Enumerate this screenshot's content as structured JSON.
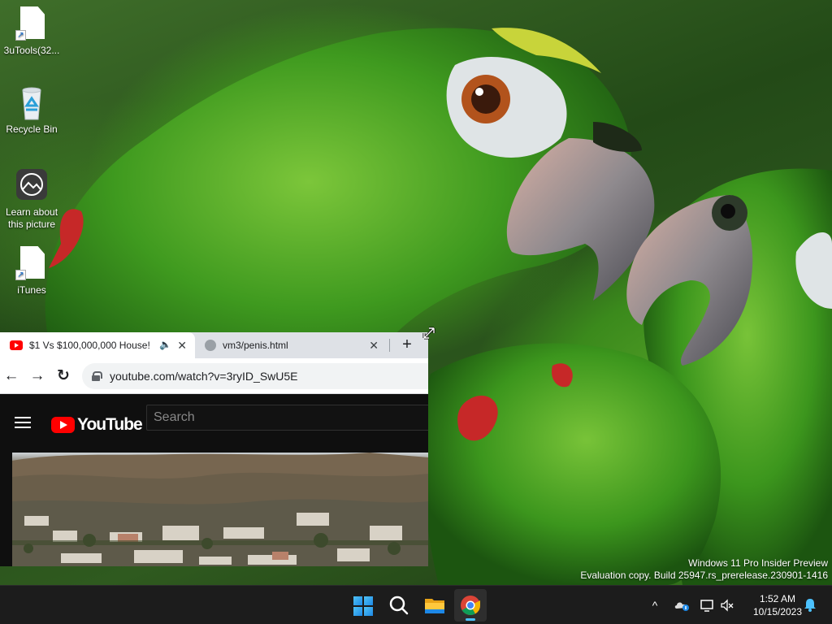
{
  "desktop": {
    "icons": [
      {
        "label": "3uTools(32...",
        "icon": "document-shortcut-icon"
      },
      {
        "label": "Recycle Bin",
        "icon": "recycle-bin-icon"
      },
      {
        "label": "Learn about this picture",
        "icon": "learn-about-picture-icon"
      },
      {
        "label": "iTunes",
        "icon": "document-shortcut-icon"
      }
    ]
  },
  "browser": {
    "tabs": [
      {
        "title": "$1 Vs $100,000,000 House!",
        "favicon": "youtube-favicon",
        "audio": "speaker-icon",
        "active": true
      },
      {
        "title": "vm3/penis.html",
        "favicon": "globe-icon",
        "active": false
      }
    ],
    "new_tab": "+",
    "url": "youtube.com/watch?v=3ryID_SwU5E",
    "nav": {
      "back": "←",
      "forward": "→",
      "reload": "↻"
    }
  },
  "youtube": {
    "logo_text": "YouTube",
    "search_placeholder": "Search"
  },
  "watermark": {
    "line1": "Windows 11 Pro Insider Preview",
    "line2": "Evaluation copy. Build 25947.rs_prerelease.230901-1416"
  },
  "taskbar": {
    "apps": [
      "start-button",
      "search-button",
      "file-explorer-button",
      "chrome-button"
    ],
    "active_app": "chrome-button",
    "tray": {
      "chevron": "^"
    },
    "clock": {
      "time": "1:52 AM",
      "date": "10/15/2023"
    }
  },
  "colors": {
    "taskbar": "#1c1c1c",
    "accent": "#4cc2ff",
    "youtube_red": "#ff0000"
  }
}
